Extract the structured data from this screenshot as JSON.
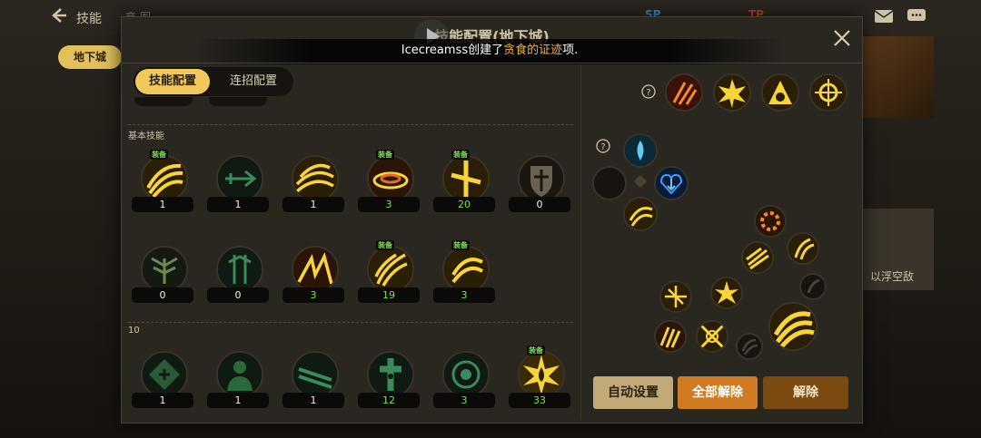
{
  "topbar": {
    "title": "技能",
    "sub": "商 图",
    "r1": "SP",
    "r2": "TP"
  },
  "side_tab": "地下城",
  "right_text": "以浮空敌",
  "panel": {
    "title": "技能配置(地下城)",
    "notice_prefix": "Icecreamss创建了",
    "notice_highlight": "贪食的证迹",
    "notice_suffix": "项.",
    "tabs": [
      "技能配置",
      "连招配置"
    ]
  },
  "sections": {
    "basic": "基本技能",
    "level10": "10"
  },
  "skills_row1": [
    {
      "val": "1",
      "equip": "装备",
      "badge": "gold"
    },
    {
      "val": "1",
      "equip": "",
      "badge": "dark"
    },
    {
      "val": "1",
      "equip": "",
      "badge": "gold"
    },
    {
      "val": "3",
      "equip": "装备",
      "badge": "gold",
      "green": true
    },
    {
      "val": "20",
      "equip": "装备",
      "badge": "gold",
      "green": true
    },
    {
      "val": "0",
      "equip": "",
      "badge": "dark"
    }
  ],
  "skills_row2": [
    {
      "val": "0",
      "equip": "",
      "badge": "dark"
    },
    {
      "val": "0",
      "equip": "",
      "badge": "dark"
    },
    {
      "val": "3",
      "equip": "",
      "badge": "gold",
      "green": true
    },
    {
      "val": "19",
      "equip": "装备",
      "badge": "gold",
      "green": true
    },
    {
      "val": "3",
      "equip": "装备",
      "badge": "gold",
      "green": true
    }
  ],
  "skills_row3": [
    {
      "val": "1",
      "equip": "",
      "badge": "dark"
    },
    {
      "val": "1",
      "equip": "",
      "badge": "dark"
    },
    {
      "val": "1",
      "equip": "",
      "badge": "dark"
    },
    {
      "val": "12",
      "equip": "",
      "badge": "dark",
      "green": true
    },
    {
      "val": "3",
      "equip": "",
      "badge": "dark",
      "green": true
    },
    {
      "val": "33",
      "equip": "装备",
      "badge": "gold",
      "green": true
    }
  ],
  "buttons": {
    "auto": "自动设置",
    "all": "全部解除",
    "remove": "解除"
  },
  "colors": {
    "accent": "#f0c95a",
    "equip_green": "#7ce14a",
    "orange": "#d07b22"
  }
}
